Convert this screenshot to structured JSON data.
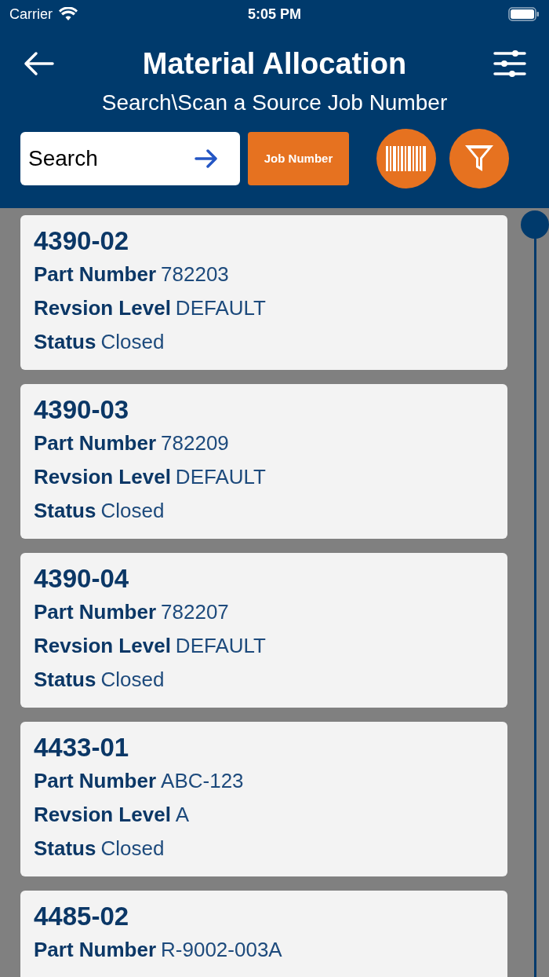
{
  "status_bar": {
    "carrier": "Carrier",
    "time": "5:05 PM"
  },
  "header": {
    "title": "Material Allocation",
    "subtitle": "Search\\Scan a Source Job Number"
  },
  "search": {
    "placeholder": "Search"
  },
  "job_number_button": "Job Number",
  "jobs": [
    {
      "number": "4390-02",
      "fields": [
        {
          "label": "Part Number",
          "value": "782203"
        },
        {
          "label": "Revsion Level",
          "value": "DEFAULT"
        },
        {
          "label": "Status",
          "value": "Closed"
        }
      ]
    },
    {
      "number": "4390-03",
      "fields": [
        {
          "label": "Part Number",
          "value": "782209"
        },
        {
          "label": "Revsion Level",
          "value": "DEFAULT"
        },
        {
          "label": "Status",
          "value": "Closed"
        }
      ]
    },
    {
      "number": "4390-04",
      "fields": [
        {
          "label": "Part Number",
          "value": "782207"
        },
        {
          "label": "Revsion Level",
          "value": "DEFAULT"
        },
        {
          "label": "Status",
          "value": "Closed"
        }
      ]
    },
    {
      "number": "4433-01",
      "fields": [
        {
          "label": "Part Number",
          "value": "ABC-123"
        },
        {
          "label": "Revsion Level",
          "value": "A"
        },
        {
          "label": "Status",
          "value": "Closed"
        }
      ]
    },
    {
      "number": "4485-02",
      "fields": [
        {
          "label": "Part Number",
          "value": "R-9002-003A"
        }
      ]
    }
  ]
}
